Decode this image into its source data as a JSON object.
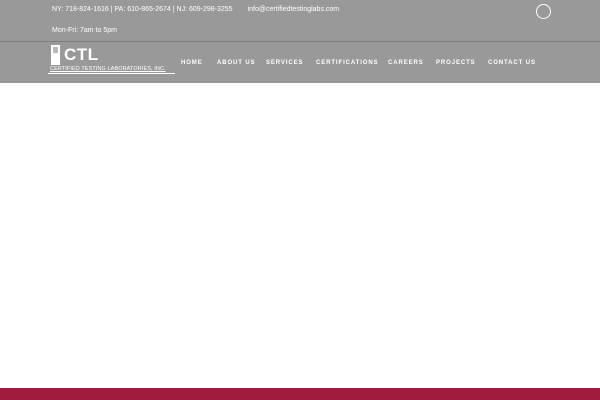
{
  "topbar": {
    "phones": "NY: 718-824-1616 | PA: 610-865-2674 | NJ: 609-298-3255",
    "email": "info@certifiedtestinglabs.com",
    "hours": "Mon-Fri: 7am to 5pm"
  },
  "logo": {
    "text": "CTL",
    "subtext": "CERTIFIED TESTING LABORATORIES, INC."
  },
  "nav": {
    "items": [
      {
        "label": "HOME"
      },
      {
        "label": "ABOUT US"
      },
      {
        "label": "SERVICES"
      },
      {
        "label": "CERTIFICATIONS"
      },
      {
        "label": "CAREERS"
      },
      {
        "label": "PROJECTS"
      },
      {
        "label": "CONTACT US"
      }
    ]
  },
  "colors": {
    "header_bg": "#999999",
    "accent": "#a01c3c",
    "text": "#ffffff"
  },
  "icons": {
    "search": "search-circle-icon"
  }
}
